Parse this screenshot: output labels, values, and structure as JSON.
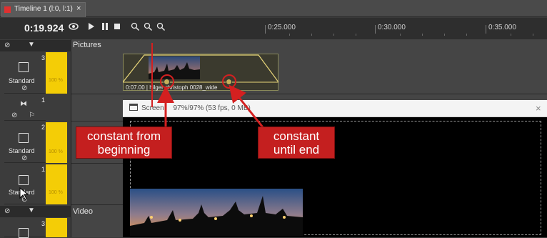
{
  "tab": {
    "title": "Timeline 1 (l:0, l:1)",
    "close_glyph": "×",
    "icon_color": "#e03030"
  },
  "toolbar": {
    "timecode": "0:19.924",
    "ruler_labels": [
      "0:25.000",
      "0:30.000",
      "0:35.000"
    ]
  },
  "tracks": {
    "section_pictures": "Pictures",
    "section_video": "Video",
    "items": [
      {
        "number": "3",
        "label": "Standard",
        "percent": "100 %"
      },
      {
        "number": "1"
      },
      {
        "number": "2",
        "label": "Standard",
        "percent": "100 %"
      },
      {
        "number": "1",
        "label": "Standard",
        "percent": "100 %"
      },
      {
        "number": "3"
      }
    ]
  },
  "clip": {
    "label": "0:07.00 | hilger christoph 0028_wide"
  },
  "screen": {
    "title": "Screen",
    "stats": "97%/97% (53 fps, 0 MB)",
    "close_glyph": "×"
  },
  "callouts": {
    "left": {
      "line1": "constant from",
      "line2": "beginning"
    },
    "right": {
      "line1": "constant",
      "line2": "until end"
    }
  },
  "colors": {
    "accent_yellow": "#f4cd06",
    "callout_red": "#c41f1f",
    "arrow_red": "#d42020"
  }
}
